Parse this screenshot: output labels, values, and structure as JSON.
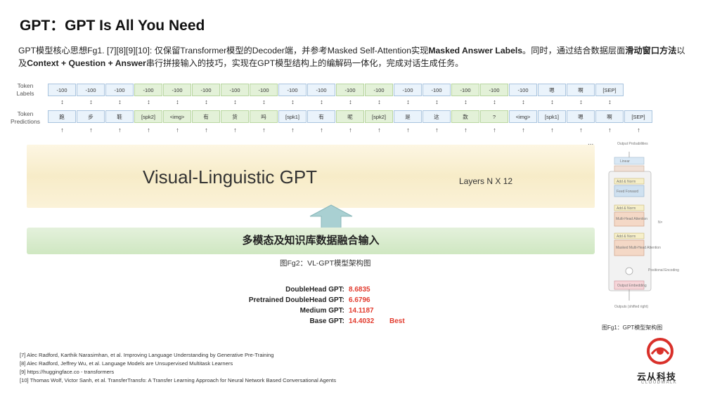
{
  "title": "GPT：GPT Is All You Need",
  "description": {
    "part1": "GPT模型核心思想Fg1. [7][8][9][10]: 仅保留Transformer模型的Decoder端，并参考Masked Self-Attention实现",
    "bold1": "Masked Answer Labels",
    "part2": "。同时，通过结合数据层面",
    "bold2": "滑动窗口方法",
    "part3": "以及",
    "bold3": "Context + Question + Answer",
    "part4": "串行拼接输入的技巧，实现在GPT模型结构上的编解码一体化，完成对话生成任务。"
  },
  "token_labels_title": [
    "Token",
    "Labels"
  ],
  "token_predictions_title": [
    "Token",
    "Predictions"
  ],
  "token_labels": [
    "-100",
    "-100",
    "-100",
    "-100",
    "-100",
    "-100",
    "-100",
    "-100",
    "-100",
    "-100",
    "-100",
    "-100",
    "-100",
    "-100",
    "-100",
    "-100",
    "-100",
    "嗯",
    "啊",
    "[SEP]"
  ],
  "token_predictions": [
    "跑",
    "步",
    "鞋",
    "[spk2]",
    "<img>",
    "有",
    "货",
    "吗",
    "[spk1]",
    "有",
    "呢",
    "[spk2]",
    "是",
    "这",
    "款",
    "?",
    "<img>",
    "[spk1]",
    "嗯",
    "啊",
    "[SEP]"
  ],
  "up_arrow_glyph": "↑",
  "updown_glyph": "↕",
  "main_model": "Visual-Linguistic GPT",
  "layers": "Layers  N X 12",
  "ellipsis": "...",
  "fusion_input": "多模态及知识库数据融合输入",
  "fig2_caption": "图Fg2：VL-GPT模型架构图",
  "results": [
    {
      "name": "DoubleHead GPT:",
      "score": "8.6835",
      "note": ""
    },
    {
      "name": "Pretrained DoubleHead GPT:",
      "score": "6.6796",
      "note": ""
    },
    {
      "name": "Medium GPT:",
      "score": "14.1187",
      "note": ""
    },
    {
      "name": "Base GPT:",
      "score": "14.4032",
      "note": "Best"
    }
  ],
  "references": [
    "[7] Alec Radford, Karthik Narasimhan, et al. Improving Language Understanding by Generative Pre-Training",
    "[8] Alec Radford, Jeffrey Wu, et al. Language Models are Unsupervised Multitask Learners",
    "[9] https://huggingface.co - transformers",
    "[10] Thomas Wolf, Victor Sanh, et al. TransferTransfo: A Transfer Learning Approach for Neural Network Based Conversational Agents"
  ],
  "fig1": {
    "caption": "图Fg1：GPT模型架构图",
    "blocks": [
      "Output Probabilities",
      "Linear",
      "Add & Norm",
      "Feed Forward",
      "Add & Norm",
      "Multi-Head Attention",
      "Add & Norm",
      "Masked Multi-Head Attention",
      "Positional Encoding",
      "Output Embedding",
      "Outputs (shifted right)",
      "N×"
    ]
  },
  "logo": {
    "name": "云从科技",
    "sub": "CLOUDWALK"
  },
  "colors": {
    "accent_red": "#e23b2e",
    "label_blue": "#eaf3fb",
    "band_yellow": "#f7ecc8",
    "band_green": "#cfe7c1",
    "arrow_teal": "#9fc7c9"
  }
}
